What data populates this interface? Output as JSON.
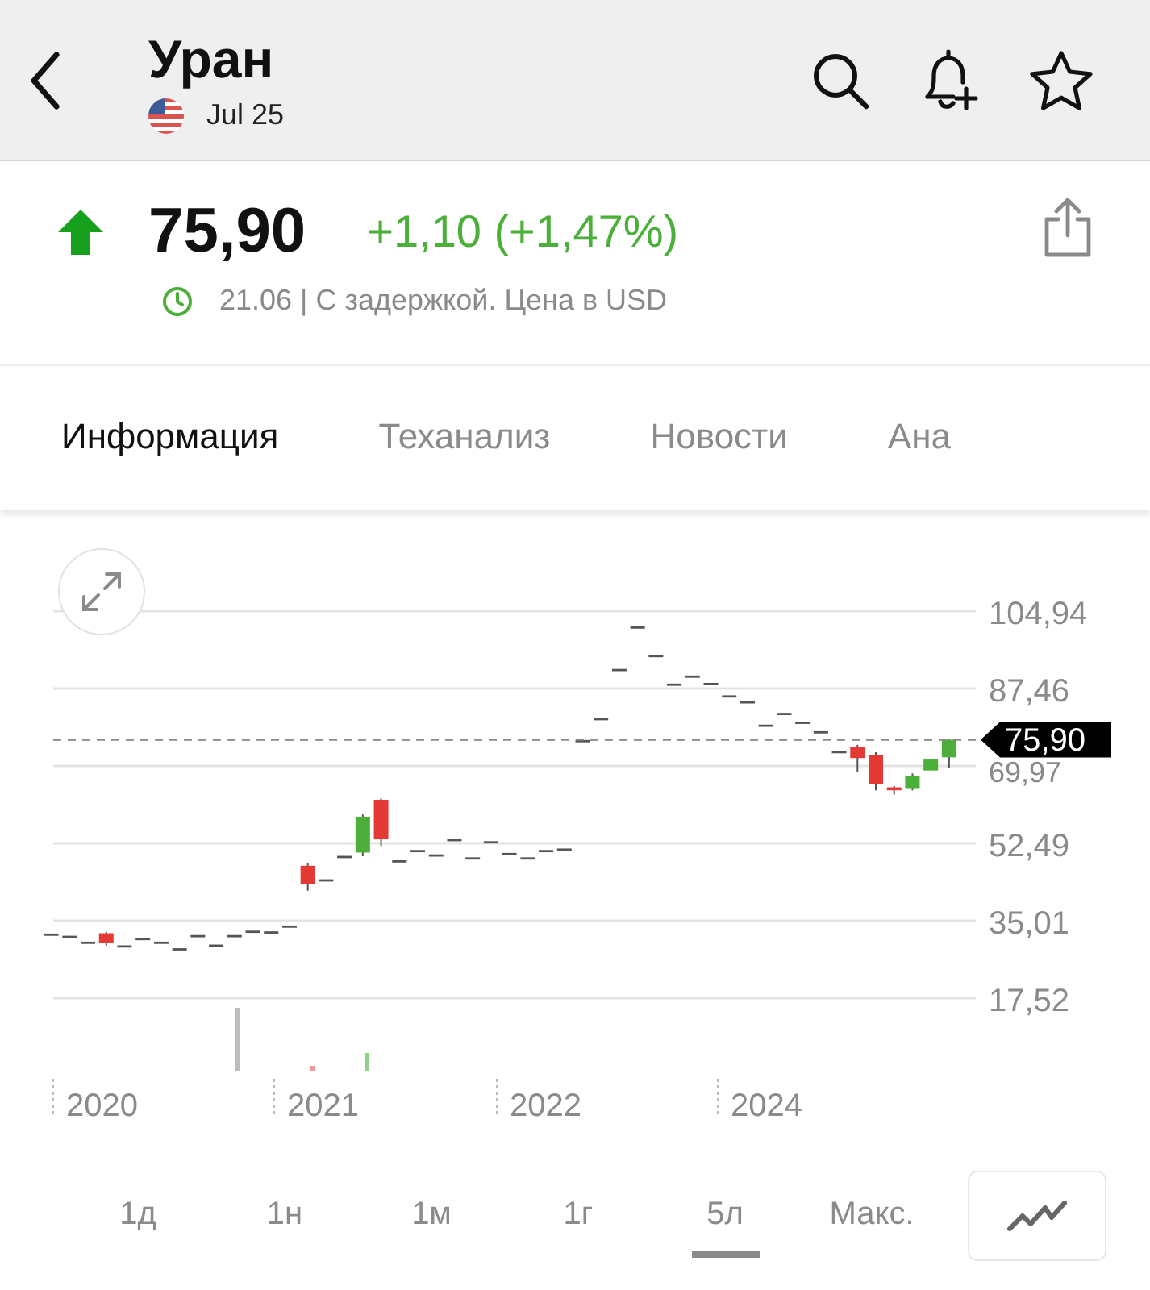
{
  "header": {
    "title": "Уран",
    "subtitle": "Jul 25"
  },
  "quote": {
    "rising": true,
    "price": "75,90",
    "change": "+1,10 (+1,47%)",
    "note": "21.06 | С задержкой. Цена в USD"
  },
  "tabs": [
    {
      "label": "Информация",
      "selected": true
    },
    {
      "label": "Теханализ",
      "selected": false
    },
    {
      "label": "Новости",
      "selected": false
    },
    {
      "label": "Ана",
      "selected": false
    }
  ],
  "chart": {
    "last_price": "75,90",
    "x_axis_labels": [
      "2020",
      "2021",
      "2022",
      "2024"
    ],
    "chart_data": {
      "type": "candlestick",
      "categories": [
        null,
        null,
        null,
        null,
        null,
        null,
        null,
        null,
        null,
        null,
        null,
        null,
        null,
        null,
        null,
        null,
        null,
        null,
        null,
        null,
        null,
        null,
        null,
        null,
        null,
        null,
        null,
        null,
        null,
        null,
        null,
        null,
        null,
        null,
        null,
        null,
        null,
        null,
        null,
        null,
        null,
        null,
        null,
        null,
        null,
        null,
        null,
        null,
        null,
        null
      ],
      "ohlc": [
        [
          31.85,
          31.85,
          31.85,
          31.85
        ],
        [
          31.36,
          31.36,
          31.36,
          31.36
        ],
        [
          30.03,
          30.03,
          30.03,
          30.03
        ],
        [
          32.18,
          32.51,
          29.37,
          30.03
        ],
        [
          29.2,
          29.2,
          29.2,
          29.2
        ],
        [
          30.86,
          30.86,
          30.86,
          30.86
        ],
        [
          30.03,
          30.03,
          30.03,
          30.03
        ],
        [
          28.54,
          28.54,
          28.54,
          28.54
        ],
        [
          31.52,
          31.52,
          31.52,
          31.52
        ],
        [
          29.37,
          29.37,
          29.37,
          29.37
        ],
        [
          31.52,
          31.52,
          31.52,
          31.52
        ],
        [
          32.51,
          32.51,
          32.51,
          32.51
        ],
        [
          32.35,
          32.35,
          32.35,
          32.35
        ],
        [
          33.67,
          33.67,
          33.67,
          33.67
        ],
        [
          47.42,
          48.08,
          41.79,
          43.28
        ],
        [
          44.11,
          44.11,
          44.11,
          44.11
        ],
        [
          49.4,
          49.4,
          49.4,
          49.4
        ],
        [
          50.4,
          59.01,
          49.57,
          58.51
        ],
        [
          62.32,
          62.65,
          51.89,
          53.38
        ],
        [
          48.41,
          48.41,
          48.41,
          48.41
        ],
        [
          50.73,
          50.73,
          50.73,
          50.73
        ],
        [
          49.74,
          49.74,
          49.74,
          49.74
        ],
        [
          53.21,
          53.21,
          53.21,
          53.21
        ],
        [
          49.07,
          49.07,
          49.07,
          49.07
        ],
        [
          52.72,
          52.72,
          52.72,
          52.72
        ],
        [
          50.07,
          50.07,
          50.07,
          50.07
        ],
        [
          49.07,
          49.07,
          49.07,
          49.07
        ],
        [
          50.73,
          50.73,
          50.73,
          50.73
        ],
        [
          51.06,
          51.06,
          51.06,
          51.06
        ],
        [
          75.57,
          75.57,
          75.57,
          75.57
        ],
        [
          80.54,
          80.54,
          80.54,
          80.54
        ],
        [
          91.63,
          91.63,
          91.63,
          91.63
        ],
        [
          101.23,
          101.23,
          101.23,
          101.23
        ],
        [
          94.78,
          94.78,
          94.78,
          94.78
        ],
        [
          88.32,
          88.32,
          88.32,
          88.32
        ],
        [
          90.14,
          90.14,
          90.14,
          90.14
        ],
        [
          88.48,
          88.48,
          88.48,
          88.48
        ],
        [
          85.67,
          85.67,
          85.67,
          85.67
        ],
        [
          84.34,
          84.34,
          84.34,
          84.34
        ],
        [
          79.05,
          79.05,
          79.05,
          79.05
        ],
        [
          81.7,
          81.7,
          81.7,
          81.7
        ],
        [
          79.71,
          79.71,
          79.71,
          79.71
        ],
        [
          77.56,
          77.56,
          77.56,
          77.56
        ],
        [
          73.09,
          73.09,
          73.09,
          73.09
        ],
        [
          74.24,
          74.74,
          68.61,
          71.76
        ],
        [
          72.42,
          73.09,
          64.47,
          65.8
        ],
        [
          65.14,
          65.47,
          63.48,
          64.47
        ],
        [
          64.97,
          68.28,
          64.47,
          67.79
        ],
        [
          68.94,
          71.76,
          68.61,
          71.42
        ],
        [
          71.92,
          76.0,
          69.44,
          75.9
        ]
      ],
      "ylim": [
        17.52,
        104.94
      ],
      "grid": true,
      "yticks": [
        {
          "value": 104.94,
          "label": "104,94"
        },
        {
          "value": 87.46,
          "label": "87,46"
        },
        {
          "value": 69.97,
          "label": "69,97"
        },
        {
          "value": 52.49,
          "label": "52,49"
        },
        {
          "value": 35.01,
          "label": "35,01"
        },
        {
          "value": 17.52,
          "label": "17,52"
        }
      ]
    }
  },
  "periods": [
    {
      "label": "1д",
      "selected": false
    },
    {
      "label": "1н",
      "selected": false
    },
    {
      "label": "1м",
      "selected": false
    },
    {
      "label": "1г",
      "selected": false
    },
    {
      "label": "5л",
      "selected": true
    },
    {
      "label": "Макс.",
      "selected": false
    }
  ]
}
